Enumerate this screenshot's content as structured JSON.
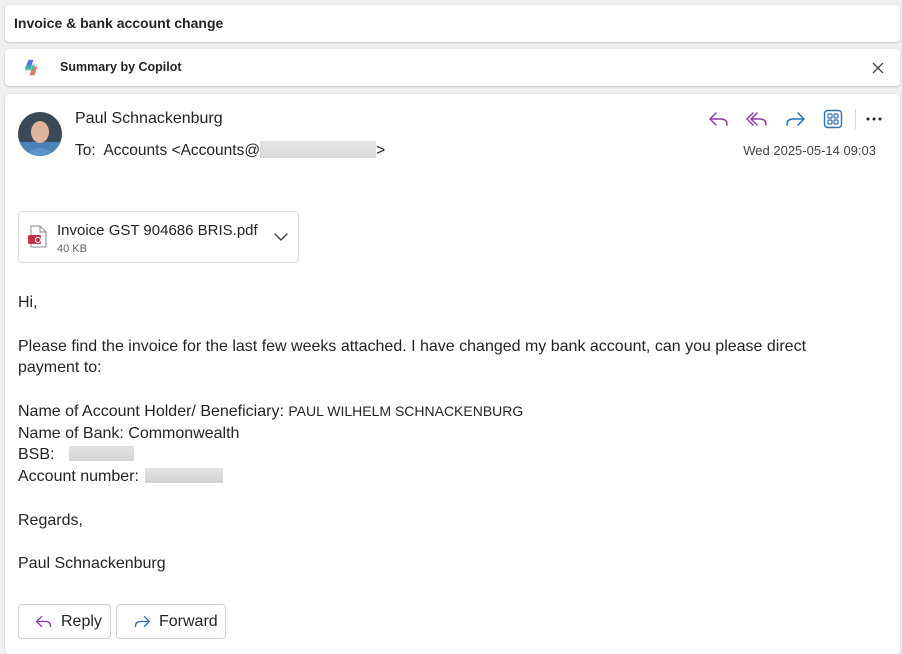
{
  "subject": "Invoice & bank account change",
  "copilot": {
    "label": "Summary by Copilot",
    "icon": "copilot-icon",
    "close_icon": "close-icon"
  },
  "message": {
    "sender_name": "Paul Schnackenburg",
    "to_prefix": "To:",
    "to_value": "Accounts <Accounts@",
    "to_suffix": ">",
    "datetime": "Wed 2025-05-14 09:03",
    "actions": [
      {
        "name": "reply-icon"
      },
      {
        "name": "reply-all-icon"
      },
      {
        "name": "forward-icon"
      },
      {
        "name": "apps-icon"
      },
      {
        "name": "more-icon"
      }
    ],
    "accent_color": "#8a3ea6",
    "forward_color": "#2b6fb5"
  },
  "attachment": {
    "name": "Invoice GST 904686 BRIS.pdf",
    "size": "40 KB",
    "icon": "pdf-icon"
  },
  "body": {
    "greeting": "Hi,",
    "paragraph1_line1": "Please find the invoice for the last few weeks attached. I have changed my bank account, can you please direct",
    "paragraph1_line2": "payment to:",
    "holder_label": "Name of Account Holder/ Beneficiary:",
    "holder_value": "PAUL WILHELM SCHNACKENBURG",
    "bank_line": "Name of Bank: Commonwealth",
    "bsb_label": "BSB:",
    "account_label": "Account number:",
    "regards": "Regards,",
    "signature": "Paul Schnackenburg"
  },
  "footer": {
    "reply_label": "Reply",
    "forward_label": "Forward"
  }
}
